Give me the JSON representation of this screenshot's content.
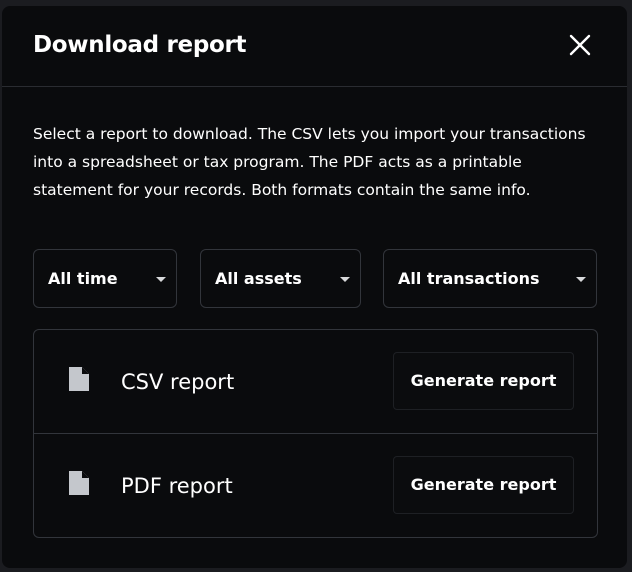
{
  "dialog": {
    "title": "Download report",
    "description": "Select a report to download. The CSV lets you import your transactions into a spreadsheet or tax program. The PDF acts as a printable statement for your records. Both formats contain the same info."
  },
  "filters": [
    {
      "label": "All time"
    },
    {
      "label": "All assets"
    },
    {
      "label": "All transactions"
    }
  ],
  "reports": [
    {
      "name": "CSV report",
      "button_label": "Generate report",
      "icon": "document-icon"
    },
    {
      "name": "PDF report",
      "button_label": "Generate report",
      "icon": "document-icon"
    }
  ],
  "colors": {
    "modal_background": "#0a0b0d",
    "backdrop": "#1b1c20",
    "border": "#32353b",
    "text": "#ffffff",
    "icon": "#c4c7cc"
  }
}
